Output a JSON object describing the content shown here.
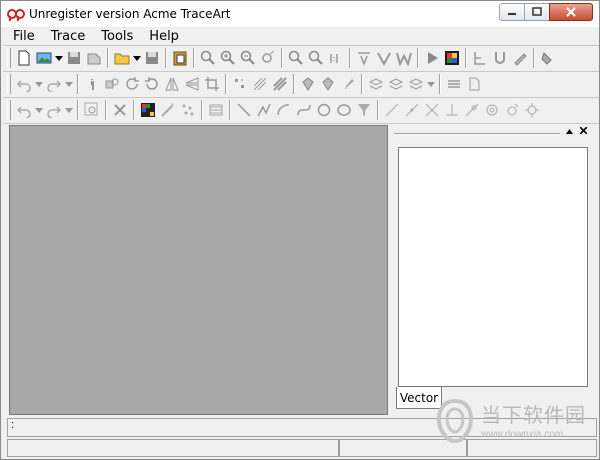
{
  "window": {
    "title": "Unregister version Acme TraceArt"
  },
  "menu": [
    "File",
    "Trace",
    "Tools",
    "Help"
  ],
  "panel": {
    "tab_label": "Vector"
  },
  "status": {
    "text": ":"
  },
  "watermark": {
    "brand": "当下软件园",
    "url": "www.downxia.com"
  },
  "colors": {
    "workarea": "#a9a9a9",
    "chrome": "#f0f0f0"
  }
}
